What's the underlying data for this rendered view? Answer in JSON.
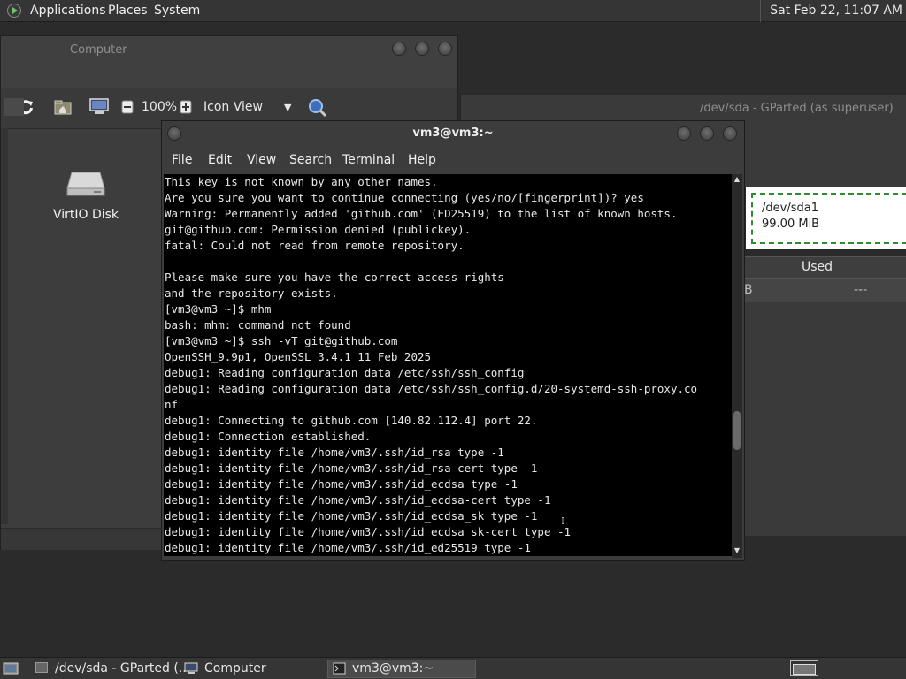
{
  "top_panel": {
    "menus": [
      "Applications",
      "Places",
      "System"
    ],
    "clock": "Sat Feb 22, 11:07 AM"
  },
  "computer_window": {
    "title": "Computer",
    "zoom": "100%",
    "view_mode": "Icon View",
    "disk_label": "VirtIO Disk"
  },
  "gparted_window": {
    "title": "/dev/sda - GParted (as superuser)",
    "partition": {
      "name": "/dev/sda1",
      "size": "99.00 MiB"
    },
    "column_used": "Used",
    "row": {
      "size_fragment": "B",
      "used": "---"
    }
  },
  "terminal": {
    "title": "vm3@vm3:~",
    "menus": [
      "File",
      "Edit",
      "View",
      "Search",
      "Terminal",
      "Help"
    ],
    "lines": [
      "This key is not known by any other names.",
      "Are you sure you want to continue connecting (yes/no/[fingerprint])? yes",
      "Warning: Permanently added 'github.com' (ED25519) to the list of known hosts.",
      "git@github.com: Permission denied (publickey).",
      "fatal: Could not read from remote repository.",
      "",
      "Please make sure you have the correct access rights",
      "and the repository exists.",
      "[vm3@vm3 ~]$ mhm",
      "bash: mhm: command not found",
      "[vm3@vm3 ~]$ ssh -vT git@github.com",
      "OpenSSH_9.9p1, OpenSSL 3.4.1 11 Feb 2025",
      "debug1: Reading configuration data /etc/ssh/ssh_config",
      "debug1: Reading configuration data /etc/ssh/ssh_config.d/20-systemd-ssh-proxy.co",
      "nf",
      "debug1: Connecting to github.com [140.82.112.4] port 22.",
      "debug1: Connection established.",
      "debug1: identity file /home/vm3/.ssh/id_rsa type -1",
      "debug1: identity file /home/vm3/.ssh/id_rsa-cert type -1",
      "debug1: identity file /home/vm3/.ssh/id_ecdsa type -1",
      "debug1: identity file /home/vm3/.ssh/id_ecdsa-cert type -1",
      "debug1: identity file /home/vm3/.ssh/id_ecdsa_sk type -1",
      "debug1: identity file /home/vm3/.ssh/id_ecdsa_sk-cert type -1",
      "debug1: identity file /home/vm3/.ssh/id_ed25519 type -1"
    ]
  },
  "taskbar": {
    "tasks": [
      "/dev/sda - GParted (...",
      "Computer",
      "vm3@vm3:~"
    ]
  },
  "colors": {
    "panel_bg": "#353535",
    "terminal_bg": "#000000",
    "partition_border": "#2e8b2e"
  }
}
